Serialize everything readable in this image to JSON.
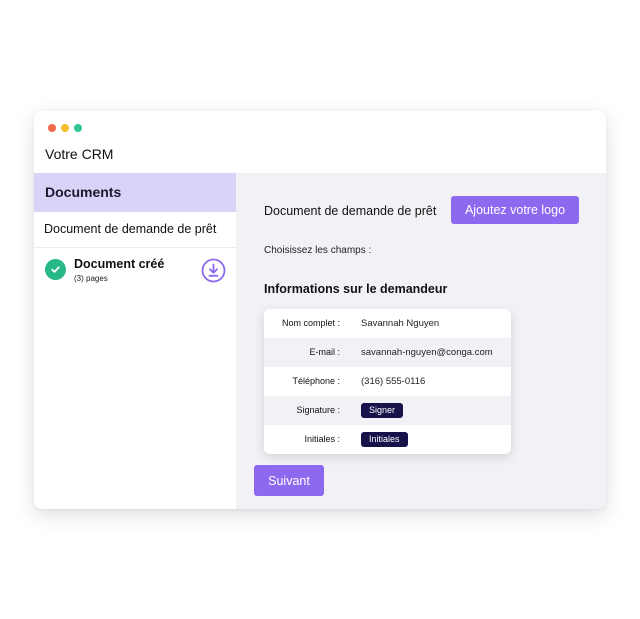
{
  "window": {
    "title": "Votre CRM",
    "controls": [
      {
        "name": "close",
        "color": "#f2694b"
      },
      {
        "name": "minimize",
        "color": "#f5bd2f"
      },
      {
        "name": "maximize",
        "color": "#30c490"
      }
    ]
  },
  "sidebar": {
    "active_section": "Documents",
    "document_item": "Document de demande de prêt",
    "created": {
      "title": "Document créé",
      "pages": "(3) pages",
      "status_icon": "check-circle-icon",
      "action_icon": "download-icon"
    }
  },
  "main": {
    "document_title": "Document de demande de prêt",
    "add_logo_label": "Ajoutez votre logo",
    "choose_fields": "Choisissez les champs :",
    "section_title": "Informations sur le demandeur",
    "fields": [
      {
        "label": "Nom complet :",
        "value": "Savannah Nguyen"
      },
      {
        "label": "E-mail :",
        "value": "savannah-nguyen@conga.com"
      },
      {
        "label": "Téléphone :",
        "value": "(316) 555-0116"
      },
      {
        "label": "Signature :",
        "button": "Signer"
      },
      {
        "label": "Initiales :",
        "button": "Initiales"
      }
    ],
    "next_label": "Suivant"
  },
  "colors": {
    "accent": "#8c69ee",
    "sidebar_active": "#d9d3f8",
    "success": "#27b889",
    "pill": "#17124a",
    "panel_bg": "#f2f1f5"
  }
}
